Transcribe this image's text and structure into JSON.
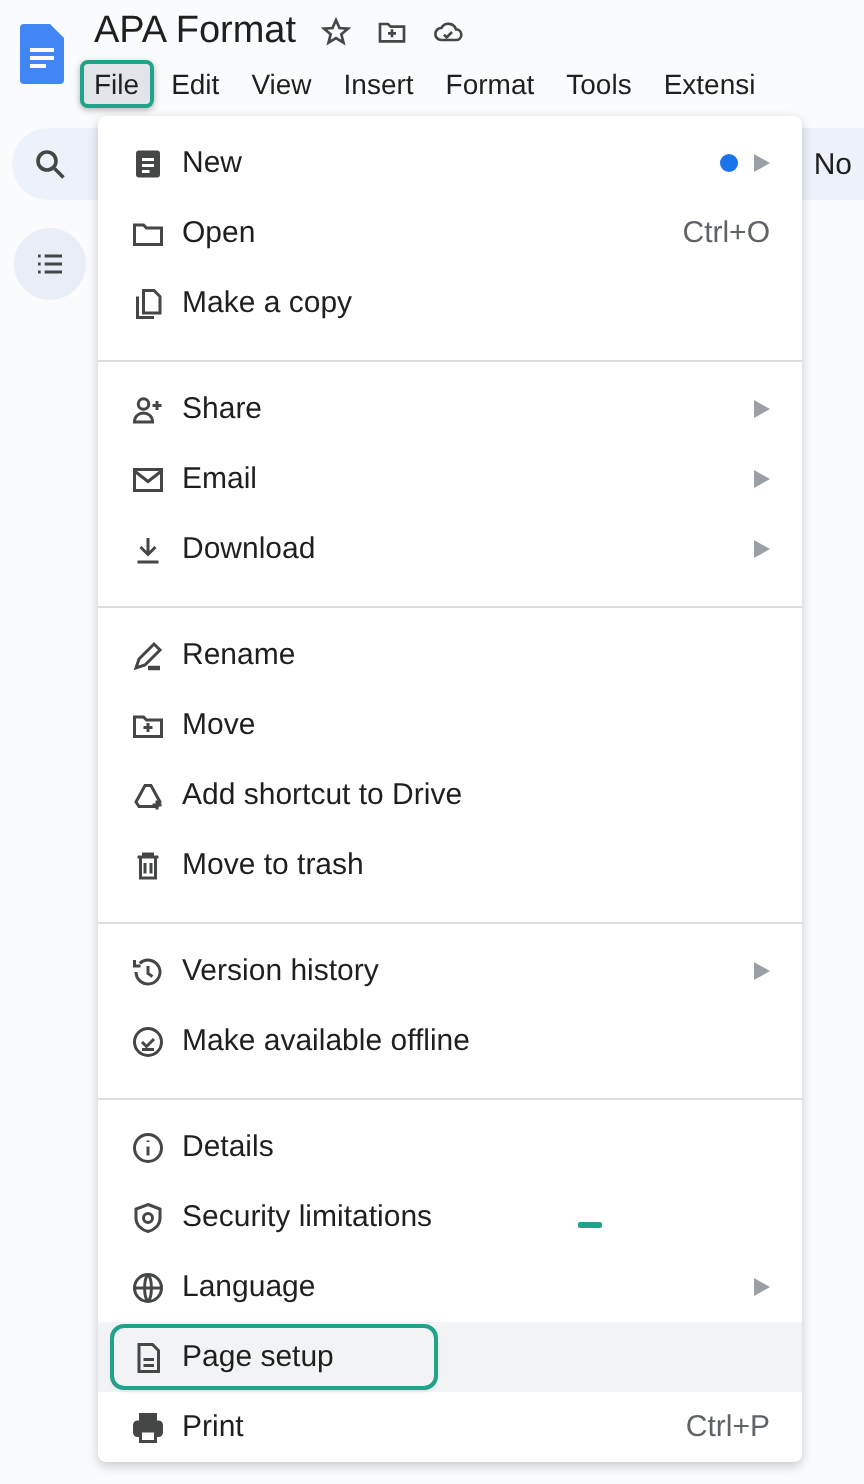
{
  "document": {
    "title": "APA Format"
  },
  "menubar": [
    {
      "label": "File",
      "selected": true
    },
    {
      "label": "Edit",
      "selected": false
    },
    {
      "label": "View",
      "selected": false
    },
    {
      "label": "Insert",
      "selected": false
    },
    {
      "label": "Format",
      "selected": false
    },
    {
      "label": "Tools",
      "selected": false
    },
    {
      "label": "Extensi",
      "selected": false
    }
  ],
  "toolbar": {
    "text": "No"
  },
  "file_menu": {
    "groups": [
      {
        "items": [
          {
            "label": "New",
            "submenu": true,
            "dot": true,
            "selected": false
          },
          {
            "label": "Open",
            "shortcut": "Ctrl+O",
            "submenu": false,
            "dot": false,
            "selected": false
          },
          {
            "label": "Make a copy",
            "submenu": false,
            "dot": false,
            "selected": false
          }
        ]
      },
      {
        "items": [
          {
            "label": "Share",
            "submenu": true,
            "dot": false,
            "selected": false
          },
          {
            "label": "Email",
            "submenu": true,
            "dot": false,
            "selected": false
          },
          {
            "label": "Download",
            "submenu": true,
            "dot": false,
            "selected": false
          }
        ]
      },
      {
        "items": [
          {
            "label": "Rename",
            "submenu": false,
            "dot": false,
            "selected": false
          },
          {
            "label": "Move",
            "submenu": false,
            "dot": false,
            "selected": false
          },
          {
            "label": "Add shortcut to Drive",
            "submenu": false,
            "dot": false,
            "selected": false
          },
          {
            "label": "Move to trash",
            "submenu": false,
            "dot": false,
            "selected": false
          }
        ]
      },
      {
        "items": [
          {
            "label": "Version history",
            "submenu": true,
            "dot": false,
            "selected": false
          },
          {
            "label": "Make available offline",
            "submenu": false,
            "dot": false,
            "selected": false
          }
        ]
      },
      {
        "items": [
          {
            "label": "Details",
            "submenu": false,
            "dot": false,
            "selected": false
          },
          {
            "label": "Security limitations",
            "submenu": false,
            "dot": false,
            "selected": false
          },
          {
            "label": "Language",
            "submenu": true,
            "dot": false,
            "selected": false
          },
          {
            "label": "Page setup",
            "submenu": false,
            "dot": false,
            "selected": true
          },
          {
            "label": "Print",
            "shortcut": "Ctrl+P",
            "submenu": false,
            "dot": false,
            "selected": false
          }
        ]
      }
    ]
  }
}
